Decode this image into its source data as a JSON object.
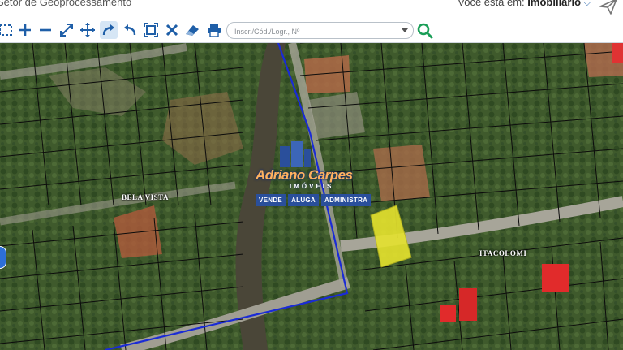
{
  "header": {
    "title": "Setor de Geoprocessamento",
    "user_prefix": "Você está em:",
    "user_location": "Imobiliário"
  },
  "toolbar": {
    "tools": [
      "select-box",
      "zoom-in",
      "zoom-out",
      "fit-extent",
      "pan",
      "redo",
      "undo",
      "zoom-window",
      "clear",
      "erase",
      "print"
    ],
    "active_tool": "redo",
    "accent_color": "#1f5fa8"
  },
  "search": {
    "placeholder": "Inscr./Cód./Logr., Nº",
    "value": ""
  },
  "map": {
    "labels": {
      "bela_vista": "BELA VISTA",
      "itacolomi": "ITACOLOMI"
    },
    "highlight_color": "#e6e32e",
    "boundary_color": "#1a2bd6"
  },
  "watermark": {
    "name": "Adriano Carpes",
    "sub": "IMÓVEIS",
    "tags": [
      "VENDE",
      "ALUGA",
      "ADMINISTRA"
    ]
  }
}
